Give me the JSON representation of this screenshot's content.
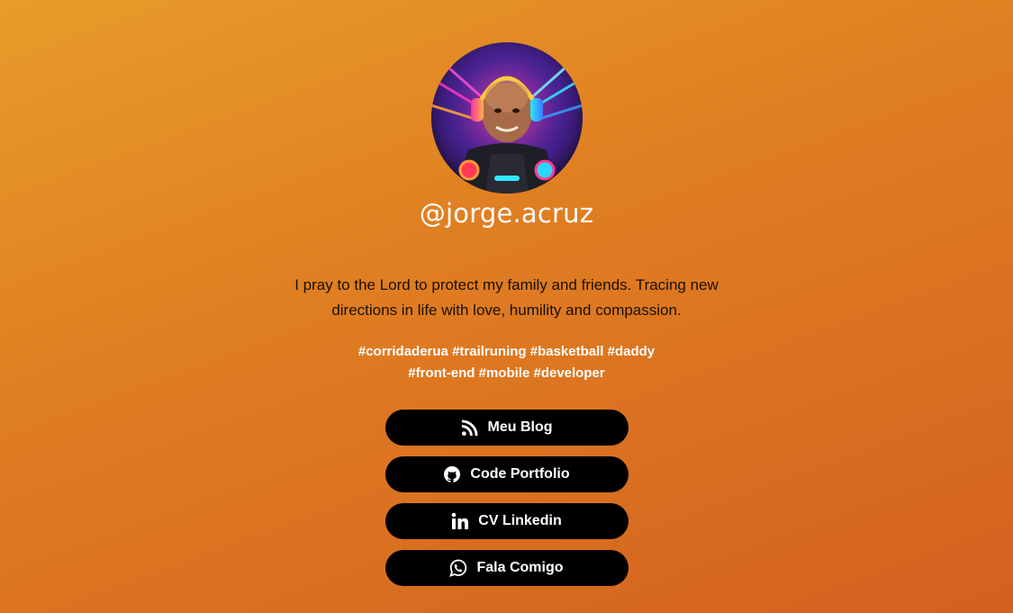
{
  "profile": {
    "username": "@jorge.acruz",
    "avatar_icon": "profile-avatar",
    "bio": "I pray to the Lord to protect my family and friends. Tracing new directions in life with love, humility and compassion.",
    "tags": "#corridaderua #trailruning #basketball #daddy #front-end #mobile #developer"
  },
  "links": [
    {
      "label": "Meu Blog",
      "icon": "rss-icon"
    },
    {
      "label": "Code Portfolio",
      "icon": "github-icon"
    },
    {
      "label": "CV Linkedin",
      "icon": "linkedin-icon"
    },
    {
      "label": "Fala Comigo",
      "icon": "whatsapp-icon"
    }
  ],
  "colors": {
    "background_start": "#e79c2a",
    "background_end": "#d4601f",
    "button_bg": "#000000",
    "button_text": "#ffffff"
  }
}
